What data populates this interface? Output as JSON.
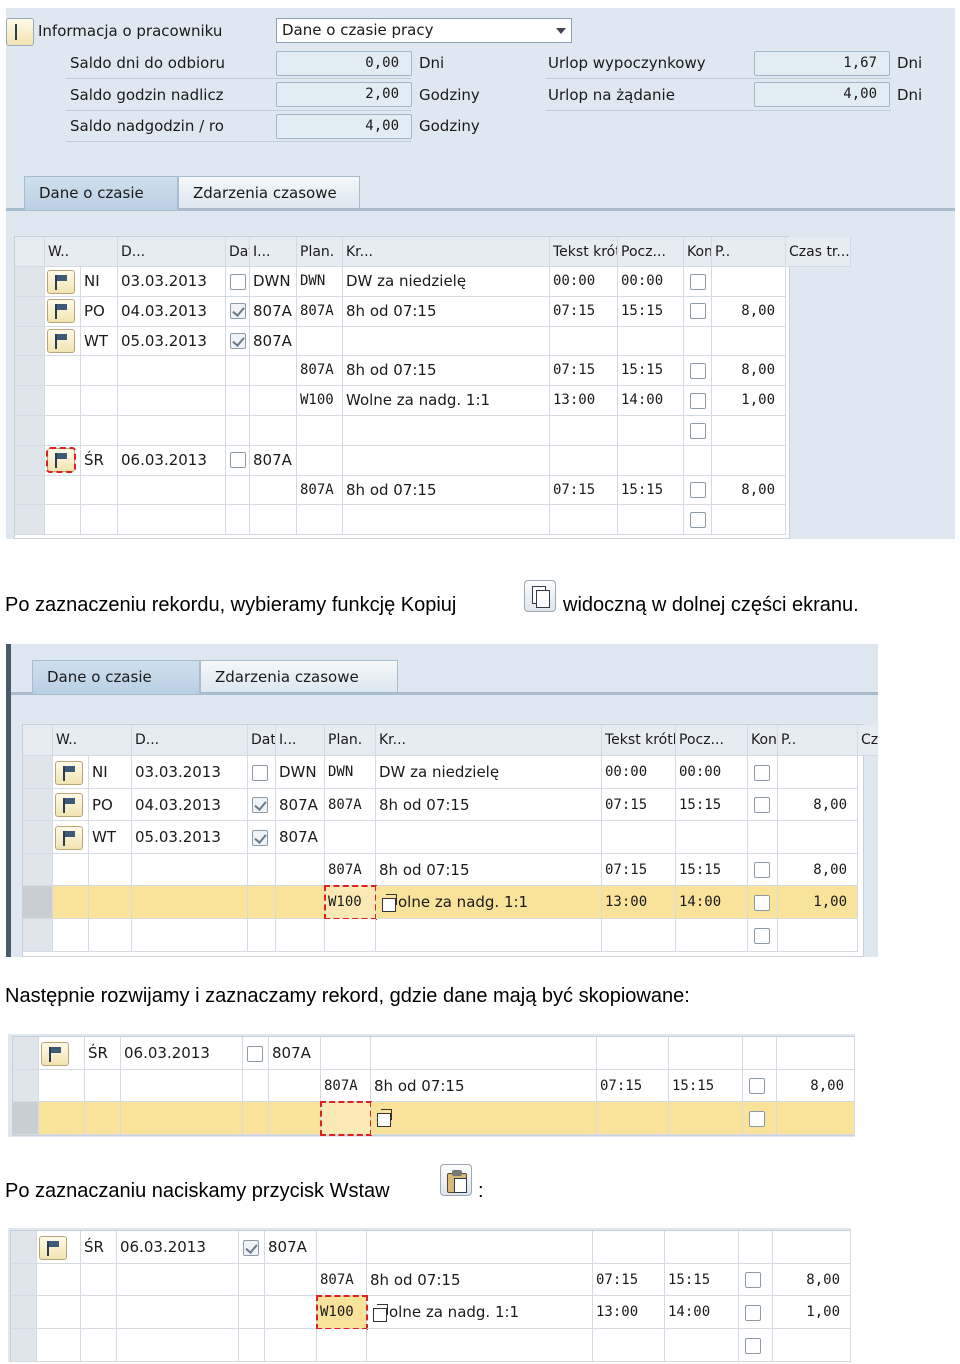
{
  "shot1": {
    "info_label": "Informacja o pracowniku",
    "dropdown_value": "Dane o czasie pracy",
    "rows": [
      {
        "label": "Saldo dni do odbioru",
        "value": "0,00",
        "unit": "Dni"
      },
      {
        "label": "Saldo godzin nadlicz",
        "value": "2,00",
        "unit": "Godziny"
      },
      {
        "label": "Saldo nadgodzin / ro",
        "value": "4,00",
        "unit": "Godziny"
      }
    ],
    "right_rows": [
      {
        "label": "Urlop wypoczynkowy",
        "value": "1,67",
        "unit": "Dni"
      },
      {
        "label": "Urlop na żądanie",
        "value": "4,00",
        "unit": "Dni"
      }
    ],
    "tabs": [
      "Dane o czasie",
      "Zdarzenia czasowe"
    ],
    "headers": [
      "W..",
      "D...",
      "Data",
      "I...",
      "Plan.",
      "Kr...",
      "Tekst krótkiego oznacz...",
      "Pocz...",
      "Koniec",
      "P..",
      "Czas tr..."
    ],
    "table": [
      {
        "icon": true,
        "day": "NI",
        "date": "03.03.2013",
        "check": "off",
        "plan": "DWN",
        "kr": "DWN",
        "text": "DW za niedzielę",
        "start": "00:00",
        "end": "00:00",
        "p": true,
        "czas": ""
      },
      {
        "icon": true,
        "day": "PO",
        "date": "04.03.2013",
        "check": "on",
        "plan": "807A",
        "kr": "807A",
        "text": "8h od 07:15",
        "start": "07:15",
        "end": "15:15",
        "p": true,
        "czas": "8,00"
      },
      {
        "icon": true,
        "day": "WT",
        "date": "05.03.2013",
        "check": "on",
        "plan": "807A",
        "kr": "",
        "text": "",
        "start": "",
        "end": "",
        "p": false,
        "czas": ""
      },
      {
        "icon": false,
        "day": "",
        "date": "",
        "check": "",
        "plan": "",
        "kr": "807A",
        "text": "8h od 07:15",
        "start": "07:15",
        "end": "15:15",
        "p": true,
        "czas": "8,00"
      },
      {
        "icon": false,
        "day": "",
        "date": "",
        "check": "",
        "plan": "",
        "kr": "W100",
        "text": "Wolne za nadg. 1:1",
        "start": "13:00",
        "end": "14:00",
        "p": true,
        "czas": "1,00"
      },
      {
        "icon": false,
        "day": "",
        "date": "",
        "check": "",
        "plan": "",
        "kr": "",
        "text": "",
        "start": "",
        "end": "",
        "p": true,
        "czas": ""
      },
      {
        "icon": true,
        "day": "ŚR",
        "date": "06.03.2013",
        "check": "off",
        "plan": "807A",
        "kr": "",
        "text": "",
        "start": "",
        "end": "",
        "p": false,
        "czas": ""
      },
      {
        "icon": false,
        "day": "",
        "date": "",
        "check": "",
        "plan": "",
        "kr": "807A",
        "text": "8h od 07:15",
        "start": "07:15",
        "end": "15:15",
        "p": true,
        "czas": "8,00"
      },
      {
        "icon": false,
        "day": "",
        "date": "",
        "check": "",
        "plan": "",
        "kr": "",
        "text": "",
        "start": "",
        "end": "",
        "p": true,
        "czas": ""
      }
    ]
  },
  "caption1a": "Po zaznaczeniu rekordu, wybieramy funkcję Kopiuj",
  "caption1b": "widoczną w dolnej części ekranu.",
  "shot2": {
    "tabs": [
      "Dane o czasie",
      "Zdarzenia czasowe"
    ],
    "headers": [
      "W..",
      "D...",
      "Data",
      "I...",
      "Plan.",
      "Kr...",
      "Tekst krótkiego oznacz...",
      "Pocz...",
      "Koniec",
      "P..",
      "Czas tr..."
    ],
    "table": [
      {
        "icon": true,
        "day": "NI",
        "date": "03.03.2013",
        "check": "off",
        "plan": "DWN",
        "kr": "DWN",
        "text": "DW za niedzielę",
        "start": "00:00",
        "end": "00:00",
        "p": true,
        "czas": ""
      },
      {
        "icon": true,
        "day": "PO",
        "date": "04.03.2013",
        "check": "on",
        "plan": "807A",
        "kr": "807A",
        "text": "8h od 07:15",
        "start": "07:15",
        "end": "15:15",
        "p": true,
        "czas": "8,00"
      },
      {
        "icon": true,
        "day": "WT",
        "date": "05.03.2013",
        "check": "on",
        "plan": "807A",
        "kr": "",
        "text": "",
        "start": "",
        "end": "",
        "p": false,
        "czas": ""
      },
      {
        "icon": false,
        "day": "",
        "date": "",
        "check": "",
        "plan": "",
        "kr": "807A",
        "text": "8h od 07:15",
        "start": "07:15",
        "end": "15:15",
        "p": true,
        "czas": "8,00"
      },
      {
        "icon": false,
        "day": "",
        "date": "",
        "check": "",
        "plan": "",
        "kr": "W100",
        "text": "olne za nadg. 1:1",
        "start": "13:00",
        "end": "14:00",
        "p": true,
        "czas": "1,00",
        "hl": true
      },
      {
        "icon": false,
        "day": "",
        "date": "",
        "check": "",
        "plan": "",
        "kr": "",
        "text": "",
        "start": "",
        "end": "",
        "p": true,
        "czas": ""
      }
    ]
  },
  "caption2": "Następnie rozwijamy i zaznaczamy rekord, gdzie dane mają być skopiowane:",
  "shot3": {
    "table": [
      {
        "icon": true,
        "day": "ŚR",
        "date": "06.03.2013",
        "check": "off",
        "plan": "807A",
        "kr": "",
        "text": "",
        "start": "",
        "end": "",
        "p": false,
        "czas": ""
      },
      {
        "icon": false,
        "day": "",
        "date": "",
        "check": "",
        "plan": "",
        "kr": "807A",
        "text": "8h od 07:15",
        "start": "07:15",
        "end": "15:15",
        "p": true,
        "czas": "8,00"
      },
      {
        "icon": false,
        "day": "",
        "date": "",
        "check": "",
        "plan": "",
        "kr": "",
        "text": "",
        "start": "",
        "end": "",
        "p": true,
        "czas": "",
        "hl": true
      }
    ]
  },
  "caption3a": "Po zaznaczaniu naciskamy przycisk Wstaw",
  "caption3b": ":",
  "shot4": {
    "table": [
      {
        "icon": true,
        "day": "ŚR",
        "date": "06.03.2013",
        "check": "on",
        "plan": "807A",
        "kr": "",
        "text": "",
        "start": "",
        "end": "",
        "p": false,
        "czas": ""
      },
      {
        "icon": false,
        "day": "",
        "date": "",
        "check": "",
        "plan": "",
        "kr": "807A",
        "text": "8h od 07:15",
        "start": "07:15",
        "end": "15:15",
        "p": true,
        "czas": "8,00"
      },
      {
        "icon": false,
        "day": "",
        "date": "",
        "check": "",
        "plan": "",
        "kr": "W100",
        "text": "olne za nadg. 1:1",
        "start": "13:00",
        "end": "14:00",
        "p": true,
        "czas": "1,00"
      },
      {
        "icon": false,
        "day": "",
        "date": "",
        "check": "",
        "plan": "",
        "kr": "",
        "text": "",
        "start": "",
        "end": "",
        "p": true,
        "czas": ""
      }
    ]
  },
  "colors": {
    "highlight": "#f9e29a",
    "panel": "#dfe8f0",
    "tab_active": "#b9cfe2"
  }
}
